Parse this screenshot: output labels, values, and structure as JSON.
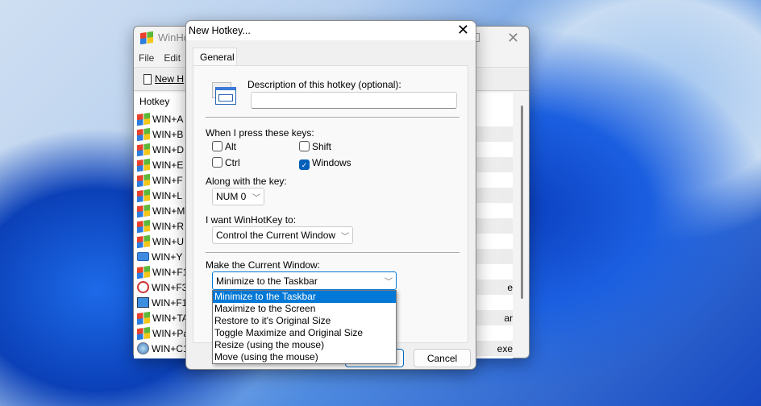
{
  "main_window": {
    "title": "WinHo",
    "menu": [
      "File",
      "Edit"
    ],
    "toolbar_new": "New H",
    "column_header": "Hotkey",
    "rows": [
      {
        "label": "WIN+A",
        "icon": "windows-flag-icon",
        "right": ""
      },
      {
        "label": "WIN+B",
        "icon": "windows-flag-icon",
        "right": ""
      },
      {
        "label": "WIN+D",
        "icon": "windows-flag-icon",
        "right": ""
      },
      {
        "label": "WIN+E",
        "icon": "windows-flag-icon",
        "right": ""
      },
      {
        "label": "WIN+F",
        "icon": "windows-flag-icon",
        "right": ""
      },
      {
        "label": "WIN+L",
        "icon": "windows-flag-icon",
        "right": ""
      },
      {
        "label": "WIN+M",
        "icon": "windows-flag-icon",
        "right": ""
      },
      {
        "label": "WIN+R",
        "icon": "windows-flag-icon",
        "right": ""
      },
      {
        "label": "WIN+U",
        "icon": "windows-flag-icon",
        "right": ""
      },
      {
        "label": "WIN+Y",
        "icon": "keyboard-icon",
        "right": ""
      },
      {
        "label": "WIN+F1",
        "icon": "windows-flag-icon",
        "right": ""
      },
      {
        "label": "WIN+F3",
        "icon": "clock-icon",
        "right": "e"
      },
      {
        "label": "WIN+F1",
        "icon": "computer-icon",
        "right": ""
      },
      {
        "label": "WIN+TA",
        "icon": "windows-flag-icon",
        "right": "ar"
      },
      {
        "label": "WIN+Pa",
        "icon": "windows-flag-icon",
        "right": ""
      },
      {
        "label": "WIN+C1",
        "icon": "safari-icon",
        "right": "exe"
      }
    ]
  },
  "dialog": {
    "title": "New Hotkey...",
    "tab": "General",
    "description_label": "Description of this hotkey (optional):",
    "description_value": "",
    "keys_label": "When I press these keys:",
    "modifiers": [
      {
        "label": "Alt",
        "checked": false
      },
      {
        "label": "Shift",
        "checked": true
      },
      {
        "label": "Ctrl",
        "checked": false
      },
      {
        "label": "Windows",
        "checked": true
      }
    ],
    "key_label": "Along with the key:",
    "key_value": "NUM 0",
    "action_label": "I want WinHotKey to:",
    "action_value": "Control the Current Window",
    "window_label": "Make the Current Window:",
    "window_value": "Minimize to the Taskbar",
    "window_options": [
      "Minimize to the Taskbar",
      "Maximize to the Screen",
      "Restore to it's Original Size",
      "Toggle Maximize and Original Size",
      "Resize (using the mouse)",
      "Move (using the mouse)"
    ],
    "cancel": "Cancel"
  }
}
